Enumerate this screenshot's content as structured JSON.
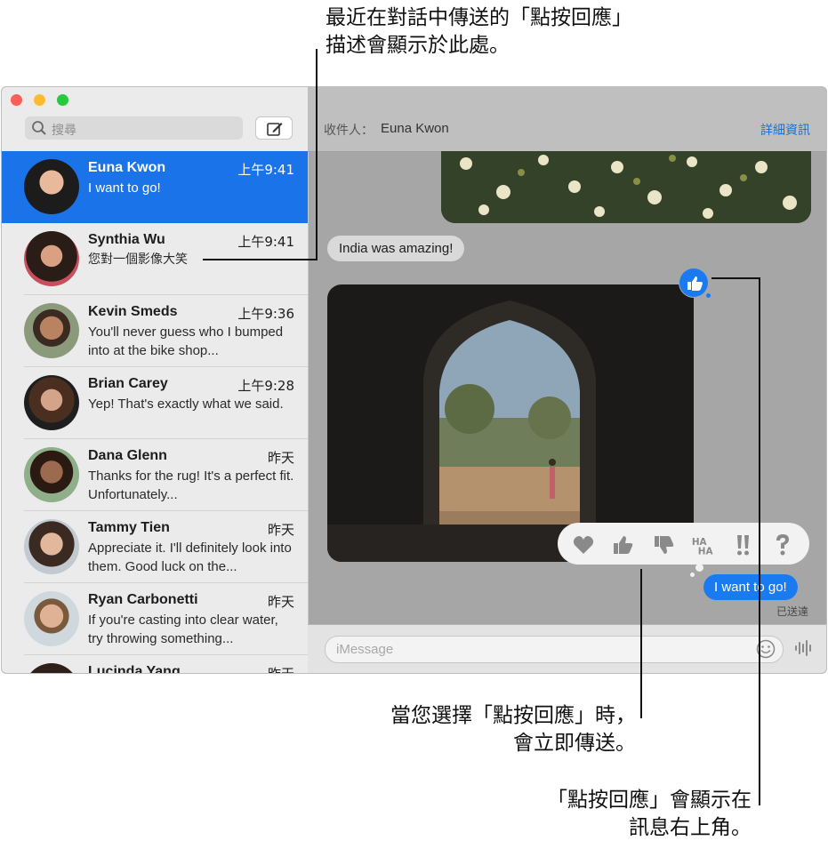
{
  "callouts": {
    "top_line1": "最近在對話中傳送的「點按回應」",
    "top_line2": "描述會顯示於此處。",
    "mid_line1": "當您選擇「點按回應」時，",
    "mid_line2": "會立即傳送。",
    "bottom_line1": "「點按回應」會顯示在",
    "bottom_line2": "訊息右上角。"
  },
  "sidebar": {
    "search_placeholder": "搜尋",
    "conversations": [
      {
        "name": "Euna Kwon",
        "time": "上午9:41",
        "preview": "I want to go!",
        "selected": true
      },
      {
        "name": "Synthia Wu",
        "time": "上午9:41",
        "preview": "您對一個影像大笑"
      },
      {
        "name": "Kevin Smeds",
        "time": "上午9:36",
        "preview": "You'll never guess who I bumped into at the bike shop..."
      },
      {
        "name": "Brian Carey",
        "time": "上午9:28",
        "preview": "Yep! That's exactly what we said."
      },
      {
        "name": "Dana Glenn",
        "time": "昨天",
        "preview": "Thanks for the rug! It's a perfect fit. Unfortunately..."
      },
      {
        "name": "Tammy Tien",
        "time": "昨天",
        "preview": "Appreciate it. I'll definitely look into them. Good luck on the..."
      },
      {
        "name": "Ryan Carbonetti",
        "time": "昨天",
        "preview": "If you're casting into clear water, try throwing something..."
      },
      {
        "name": "Lucinda Yang",
        "time": "昨天",
        "preview": ""
      }
    ]
  },
  "header": {
    "to_label": "收件人：",
    "recipient": "Euna Kwon",
    "details": "詳細資訊"
  },
  "messages": {
    "received_text": "India was amazing!",
    "sent_text": "I want to go!",
    "delivered": "已送達"
  },
  "input": {
    "placeholder": "iMessage"
  },
  "tapbacks": [
    "heart-icon",
    "thumbs-up-icon",
    "thumbs-down-icon",
    "haha-icon",
    "exclamation-icon",
    "question-icon"
  ],
  "colors": {
    "accent": "#1a73e8",
    "sent_bubble": "#1a7bf0",
    "received_bubble": "#d9d9d9"
  }
}
